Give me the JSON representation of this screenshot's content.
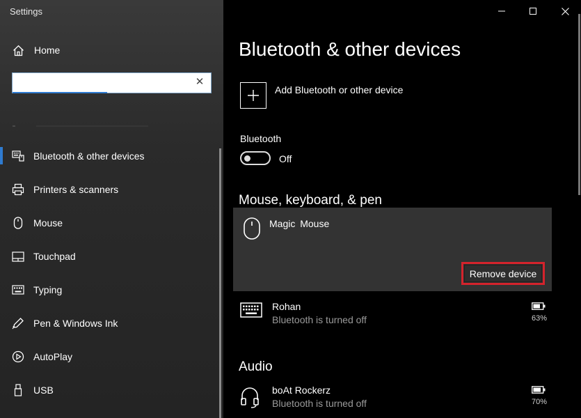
{
  "window": {
    "title": "Settings",
    "controls": [
      "minimize-icon",
      "maximize-icon",
      "close-icon"
    ]
  },
  "sidebar": {
    "home_label": "Home",
    "search": {
      "value": "",
      "placeholder": ""
    },
    "items": [
      {
        "label": "Bluetooth & other devices",
        "icon": "bluetooth-devices-icon",
        "active": true
      },
      {
        "label": "Printers & scanners",
        "icon": "printer-icon",
        "active": false
      },
      {
        "label": "Mouse",
        "icon": "mouse-icon",
        "active": false
      },
      {
        "label": "Touchpad",
        "icon": "touchpad-icon",
        "active": false
      },
      {
        "label": "Typing",
        "icon": "keyboard-icon",
        "active": false
      },
      {
        "label": "Pen & Windows Ink",
        "icon": "pen-icon",
        "active": false
      },
      {
        "label": "AutoPlay",
        "icon": "autoplay-icon",
        "active": false
      },
      {
        "label": "USB",
        "icon": "usb-icon",
        "active": false
      }
    ]
  },
  "main": {
    "title": "Bluetooth & other devices",
    "add_device_label": "Add Bluetooth or other device",
    "bluetooth": {
      "label": "Bluetooth",
      "state": "Off"
    },
    "sections": {
      "mouse_keyboard_pen": "Mouse, keyboard, & pen",
      "audio": "Audio"
    },
    "devices": {
      "mouse": {
        "name": "Magic  Mouse",
        "remove_label": "Remove device"
      },
      "keyboard": {
        "name": "Rohan",
        "status": "Bluetooth is turned off",
        "battery": "63%"
      },
      "headset": {
        "name": "boAt Rockerz",
        "status": "Bluetooth is turned off",
        "battery": "70%"
      }
    }
  },
  "colors": {
    "accent": "#2f7bd0",
    "highlight": "#d4232c"
  }
}
